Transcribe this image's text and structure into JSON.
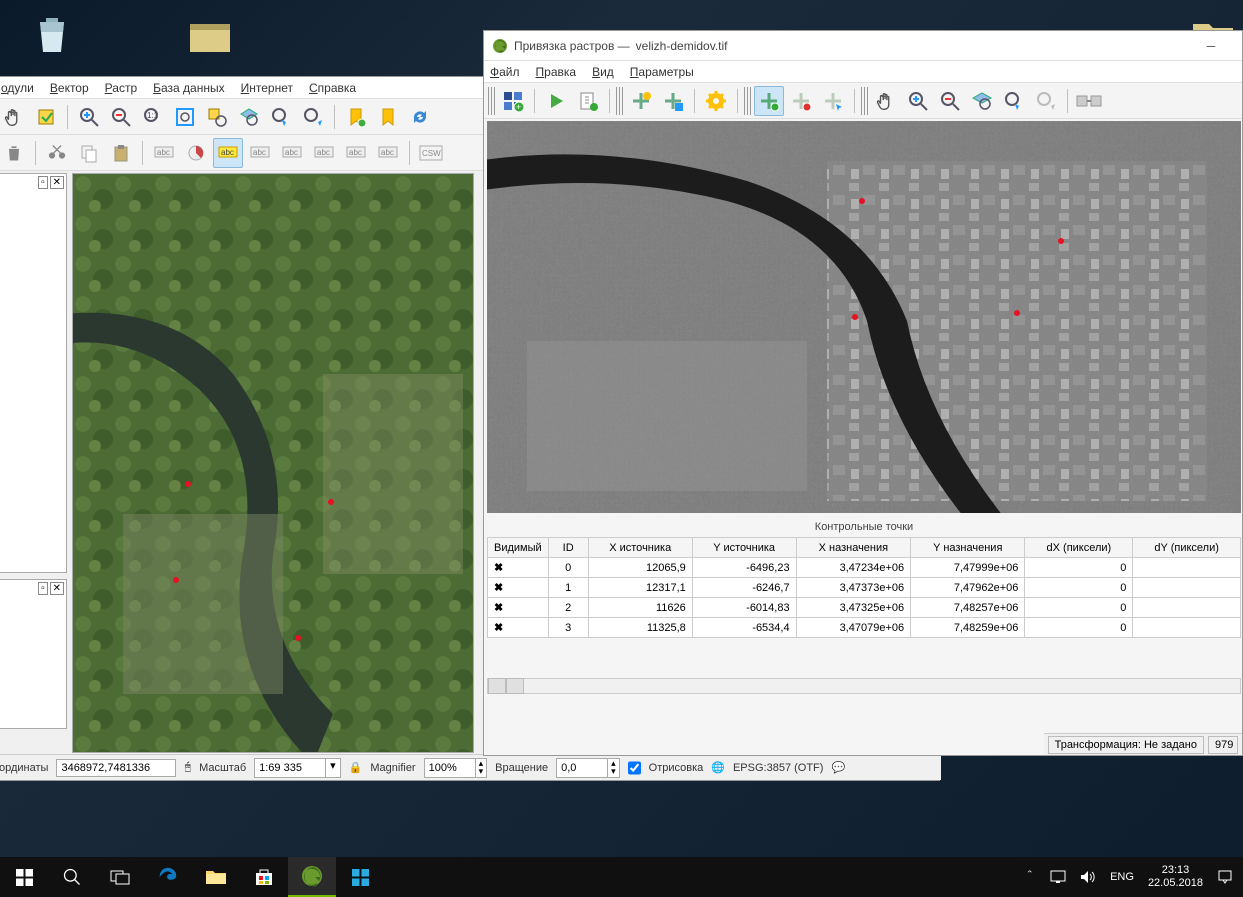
{
  "desktop": {
    "recycle_bin": "Корзина"
  },
  "georef": {
    "title_prefix": "Привязка растров —",
    "file": "velizh-demidov.tif",
    "menu": {
      "file": "Файл",
      "edit": "Правка",
      "view": "Вид",
      "params": "Параметры"
    },
    "panel_title": "Контрольные точки",
    "table": {
      "headers": {
        "vis": "Видимый",
        "id": "ID",
        "xs": "X источника",
        "ys": "Y источника",
        "xd": "X назначения",
        "yd": "Y назначения",
        "dx": "dX (пиксели)",
        "dy": "dY (пиксели)"
      },
      "rows": [
        {
          "id": "0",
          "xs": "12065,9",
          "ys": "-6496,23",
          "xd": "3,47234e+06",
          "yd": "7,47999e+06",
          "dx": "0"
        },
        {
          "id": "1",
          "xs": "12317,1",
          "ys": "-6246,7",
          "xd": "3,47373e+06",
          "yd": "7,47962e+06",
          "dx": "0"
        },
        {
          "id": "2",
          "xs": "11626",
          "ys": "-6014,83",
          "xd": "3,47325e+06",
          "yd": "7,48257e+06",
          "dx": "0"
        },
        {
          "id": "3",
          "xs": "11325,8",
          "ys": "-6534,4",
          "xd": "3,47079e+06",
          "yd": "7,48259e+06",
          "dx": "0"
        }
      ]
    },
    "status": {
      "transform": "Трансформация: Не задано",
      "value": "979"
    }
  },
  "qgis": {
    "menu": {
      "modules": "одули",
      "vector": "Вектор",
      "raster": "Растр",
      "db": "База данных",
      "internet": "Интернет",
      "help": "Справка"
    },
    "status": {
      "coord_label": "ординаты",
      "coord": "3468972,7481336",
      "scale_label": "Масштаб",
      "scale": "1:69 335",
      "mag_label": "Magnifier",
      "mag": "100%",
      "rot_label": "Вращение",
      "rot": "0,0",
      "render_label": "Отрисовка",
      "crs": "EPSG:3857 (OTF)"
    }
  },
  "tray": {
    "lang": "ENG",
    "time": "23:13",
    "date": "22.05.2018"
  }
}
